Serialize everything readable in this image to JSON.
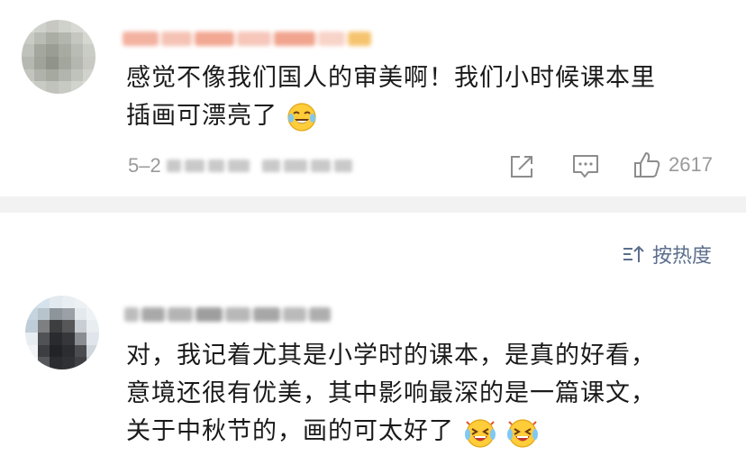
{
  "comments": [
    {
      "text_line1": "感觉不像我们国人的审美啊！我们小时候课本里",
      "text_line2": "插画可漂亮了",
      "emoji": "laughing-crying-emoji",
      "date_prefix": "5–2",
      "like_count": "2617"
    },
    {
      "text_line1": "对，我记着尤其是小学时的课本，是真的好看，",
      "text_line2": "意境还很有优美，其中影响最深的是一篇课文，",
      "text_line3": "关于中秋节的，画的可太好了",
      "emojis": [
        "grinning-sweat-emoji",
        "grinning-sweat-emoji"
      ]
    }
  ],
  "sort": {
    "label": "按热度",
    "icon": "sort-icon"
  },
  "colors": {
    "text": "#1a1a1a",
    "meta": "#9a9a9a",
    "sort": "#5b6e8c",
    "divider": "#f2f2f2"
  }
}
